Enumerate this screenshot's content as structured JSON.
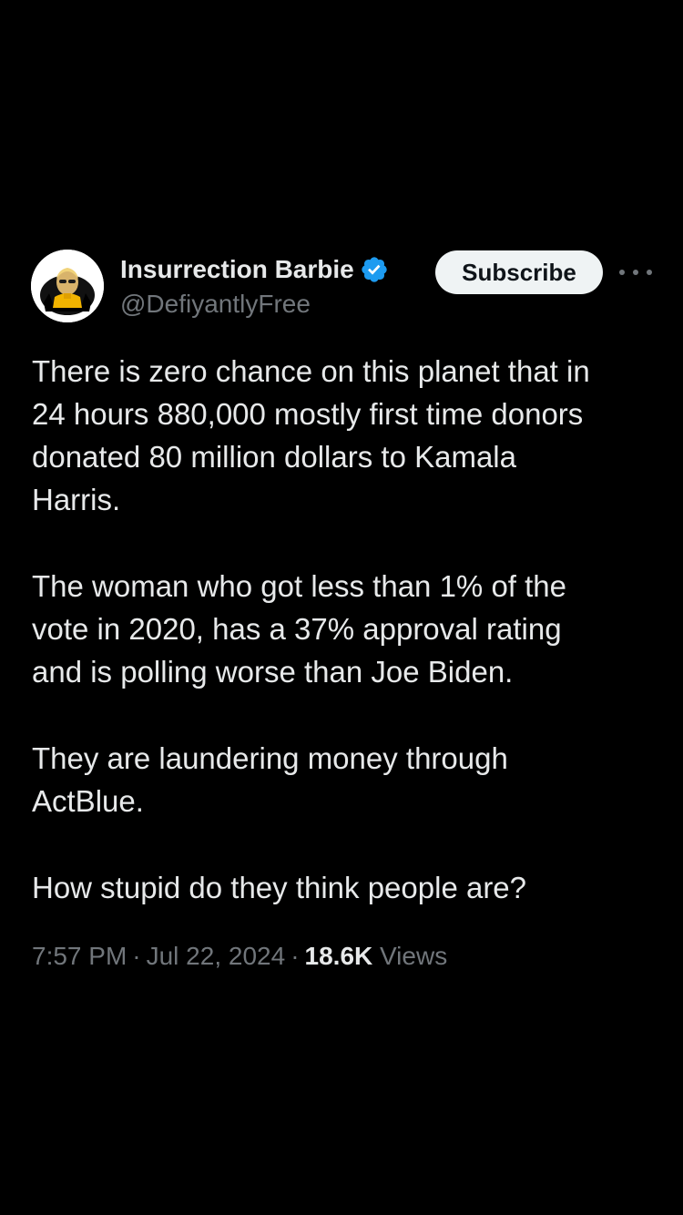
{
  "author": {
    "display_name": "Insurrection Barbie",
    "handle": "@DefiyantlyFree",
    "verified": true,
    "verified_color": "#1d9bf0",
    "avatar_icon": "profile-avatar"
  },
  "actions": {
    "subscribe_label": "Subscribe",
    "more_icon": "more-horizontal-icon"
  },
  "tweet": {
    "paragraphs": [
      "There is zero chance on this planet that in\n24 hours 880,000 mostly first time donors\ndonated 80 million dollars to Kamala\nHarris.",
      "The woman who got less than 1% of the\nvote in 2020, has a 37% approval rating\nand is polling worse than Joe Biden.",
      "They are laundering money through\nActBlue.",
      "How stupid do they think people are?"
    ],
    "time": "7:57 PM",
    "separator": "·",
    "date": "Jul 22, 2024",
    "views_count": "18.6K",
    "views_label": "Views"
  },
  "colors": {
    "background": "#000000",
    "text_primary": "#e7e9ea",
    "text_secondary": "#71767b",
    "button_bg": "#eff3f4",
    "button_text": "#0f1419"
  }
}
